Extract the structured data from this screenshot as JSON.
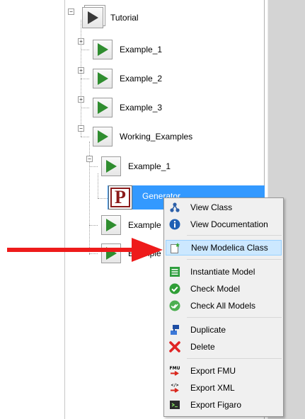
{
  "tree": {
    "root": {
      "label": "Tutorial",
      "icon": "package-icon"
    },
    "items": [
      {
        "label": "Example_1"
      },
      {
        "label": "Example_2"
      },
      {
        "label": "Example_3"
      },
      {
        "label": "Working_Examples"
      },
      {
        "label": "Example_1"
      },
      {
        "label": "Generator",
        "selected": true,
        "icon": "p-class-icon",
        "icon_letter": "P"
      },
      {
        "label": "Example"
      },
      {
        "label": "Example"
      }
    ],
    "expander_collapsed": "+",
    "expander_expanded": "−"
  },
  "context_menu": {
    "items": [
      {
        "label": "View Class",
        "icon": "view-class-icon"
      },
      {
        "label": "View Documentation",
        "icon": "info-icon"
      },
      {
        "label": "New Modelica Class",
        "icon": "new-class-icon",
        "highlighted": true
      },
      {
        "label": "Instantiate Model",
        "icon": "instantiate-icon"
      },
      {
        "label": "Check Model",
        "icon": "check-icon"
      },
      {
        "label": "Check All Models",
        "icon": "check-all-icon"
      },
      {
        "label": "Duplicate",
        "icon": "duplicate-icon"
      },
      {
        "label": "Delete",
        "icon": "delete-icon"
      },
      {
        "label": "Export FMU",
        "icon": "fmu-icon",
        "icon_text": "FMU"
      },
      {
        "label": "Export XML",
        "icon": "xml-icon",
        "icon_text": "</>"
      },
      {
        "label": "Export Figaro",
        "icon": "figaro-icon"
      }
    ]
  },
  "annotation": {
    "arrow_color": "#ee1b1b"
  },
  "colors": {
    "selection": "#3399ff",
    "menu_highlight": "#cce8ff",
    "play_green": "#2f8d2f"
  }
}
